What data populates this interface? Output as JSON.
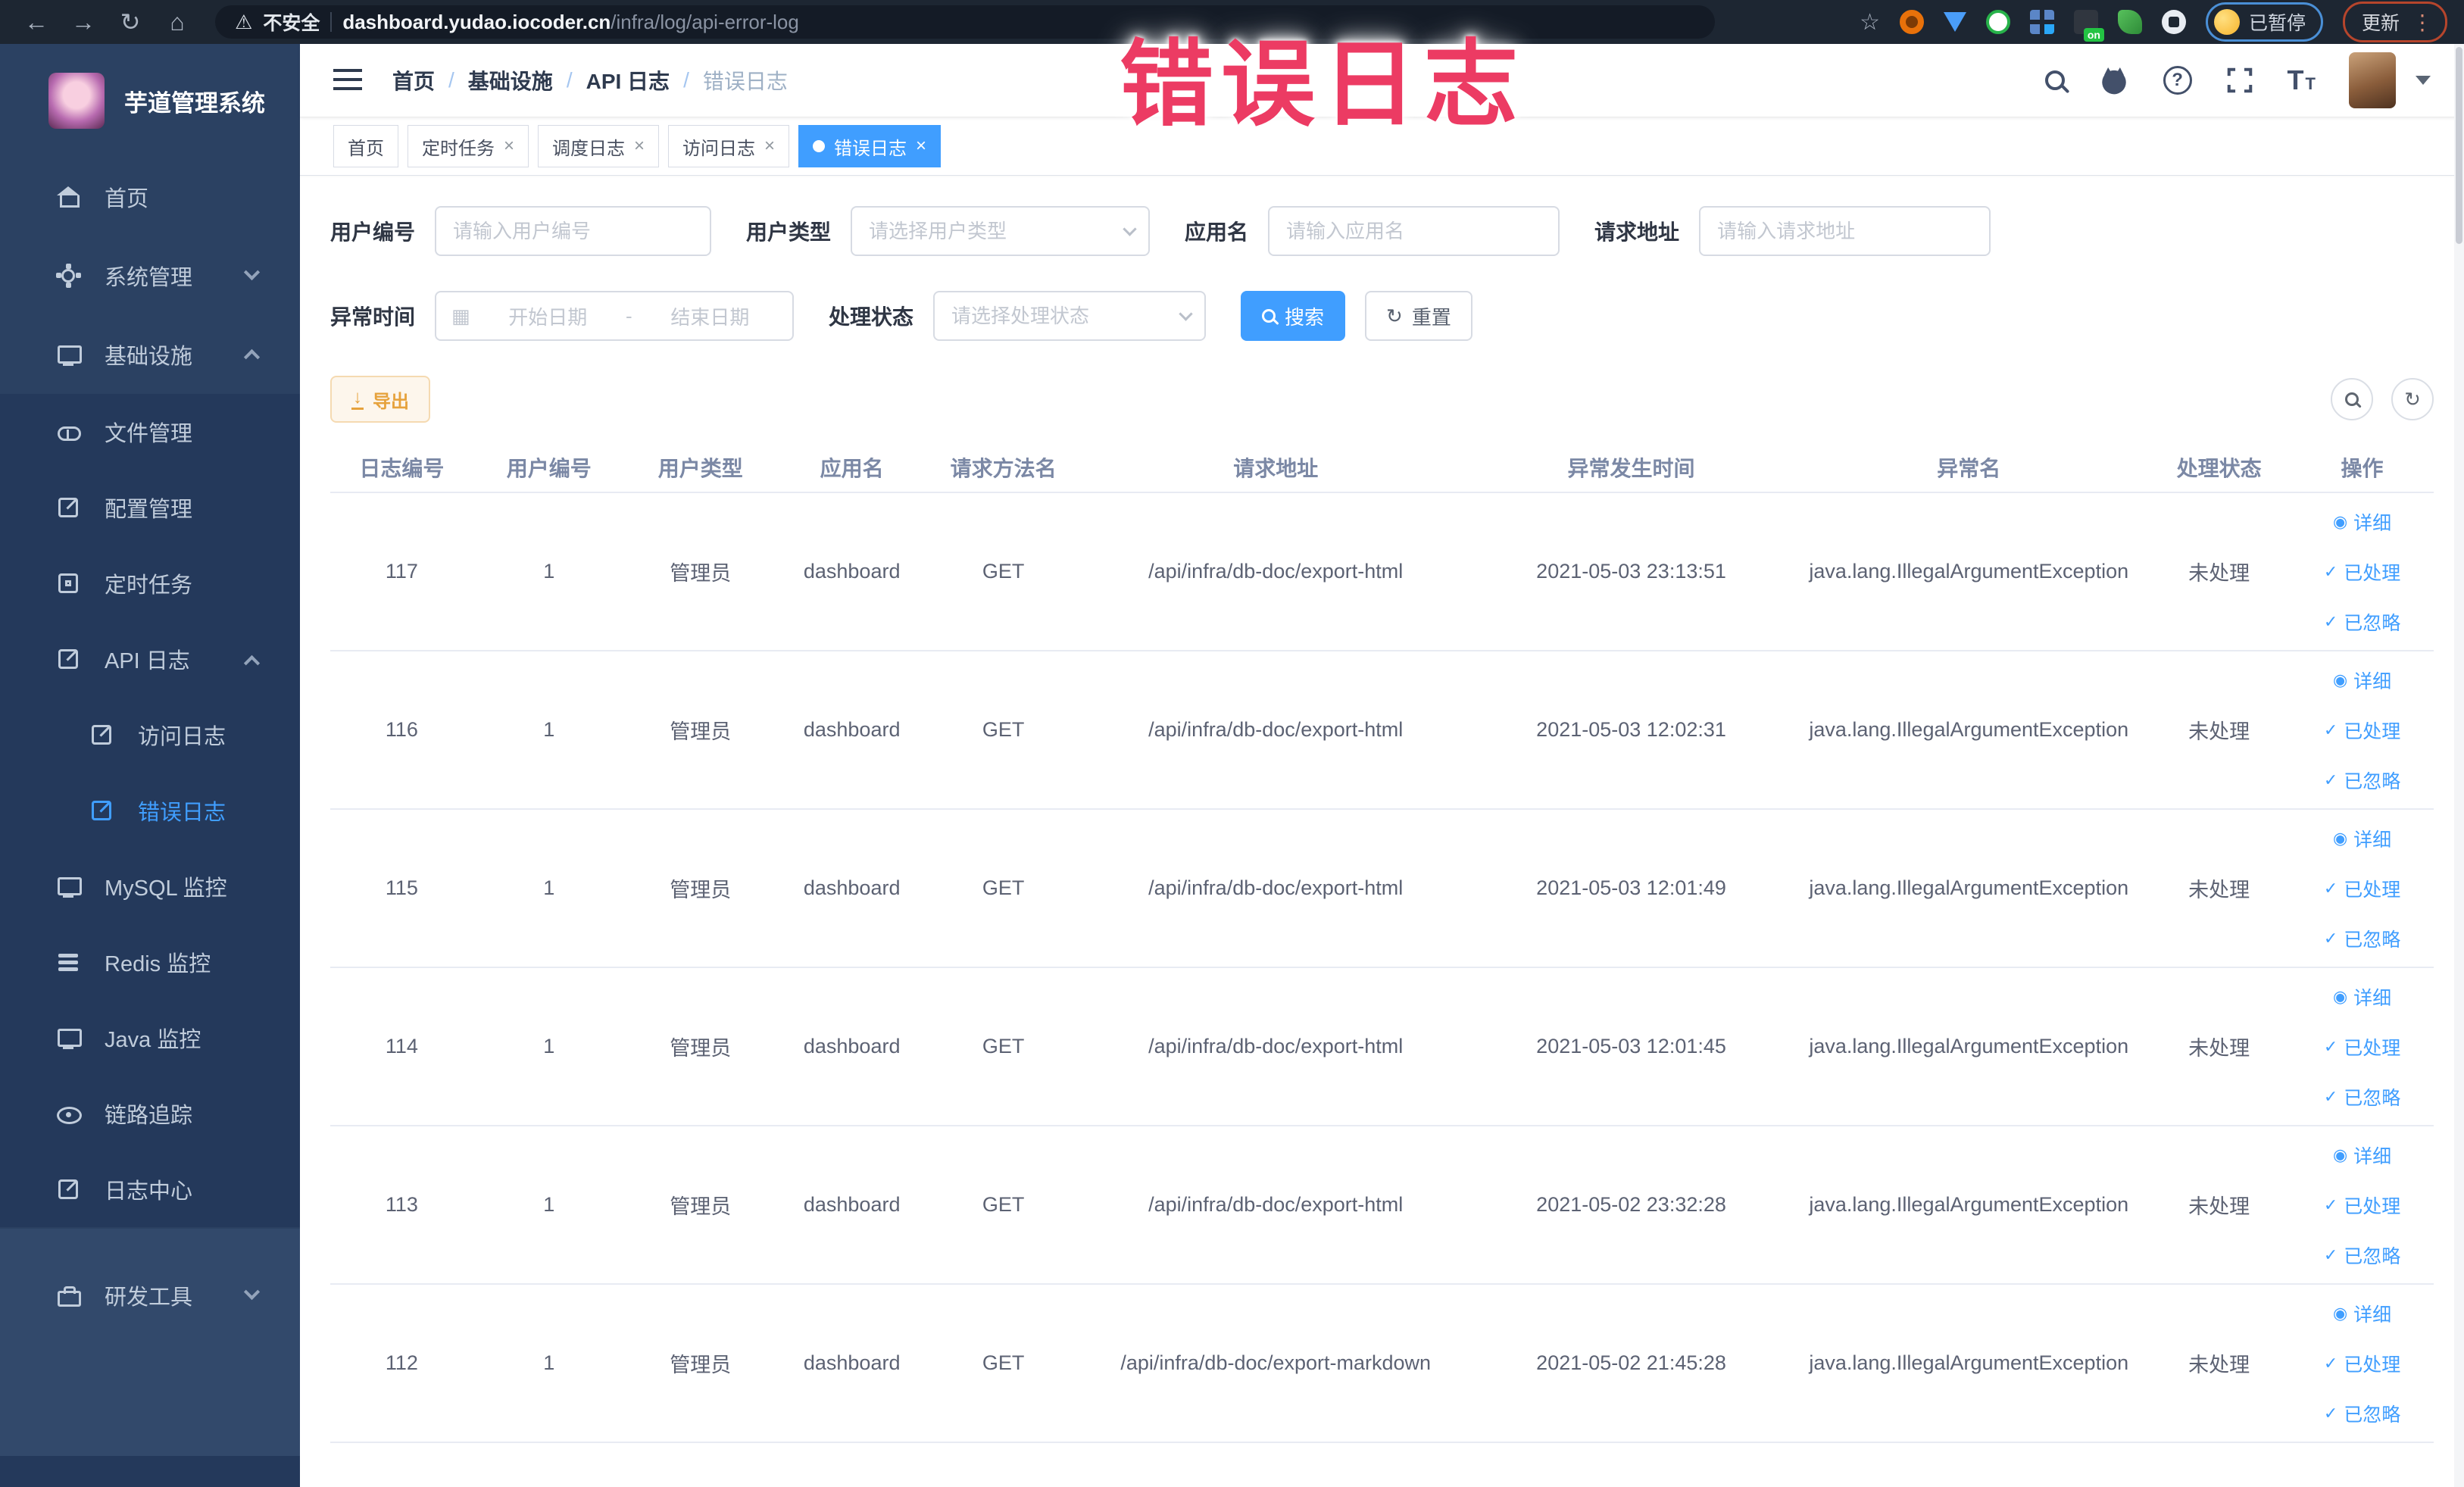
{
  "browser": {
    "security_label": "不安全",
    "url_host": "dashboard.yudao.iocoder.cn",
    "url_path": "/infra/log/api-error-log",
    "ext_on_badge": "on",
    "paused_badge": "已暂停",
    "update_button": "更新"
  },
  "overlay": {
    "title": "错误日志",
    "color": "#EC3B63"
  },
  "sidebar": {
    "app_title": "芋道管理系统",
    "items": [
      {
        "label": "首页"
      },
      {
        "label": "系统管理"
      },
      {
        "label": "基础设施"
      },
      {
        "label": "文件管理"
      },
      {
        "label": "配置管理"
      },
      {
        "label": "定时任务"
      },
      {
        "label": "API 日志"
      },
      {
        "label": "访问日志"
      },
      {
        "label": "错误日志"
      },
      {
        "label": "MySQL 监控"
      },
      {
        "label": "Redis 监控"
      },
      {
        "label": "Java 监控"
      },
      {
        "label": "链路追踪"
      },
      {
        "label": "日志中心"
      },
      {
        "label": "研发工具"
      }
    ]
  },
  "header": {
    "breadcrumb": [
      "首页",
      "基础设施",
      "API 日志",
      "错误日志"
    ],
    "separator": "/"
  },
  "tabs": [
    {
      "label": "首页"
    },
    {
      "label": "定时任务"
    },
    {
      "label": "调度日志"
    },
    {
      "label": "访问日志"
    },
    {
      "label": "错误日志"
    }
  ],
  "filters": {
    "user_id": {
      "label": "用户编号",
      "placeholder": "请输入用户编号"
    },
    "user_type": {
      "label": "用户类型",
      "placeholder": "请选择用户类型"
    },
    "app_name": {
      "label": "应用名",
      "placeholder": "请输入应用名"
    },
    "request_url": {
      "label": "请求地址",
      "placeholder": "请输入请求地址"
    },
    "exception_time": {
      "label": "异常时间",
      "start_placeholder": "开始日期",
      "separator": "-",
      "end_placeholder": "结束日期"
    },
    "process_status": {
      "label": "处理状态",
      "placeholder": "请选择处理状态"
    },
    "search_button": "搜索",
    "reset_button": "重置"
  },
  "toolbar": {
    "export_button": "导出"
  },
  "table": {
    "columns": [
      "日志编号",
      "用户编号",
      "用户类型",
      "应用名",
      "请求方法名",
      "请求地址",
      "异常发生时间",
      "异常名",
      "处理状态",
      "操作"
    ],
    "row_actions": [
      "详细",
      "已处理",
      "已忽略"
    ],
    "rows": [
      {
        "id": "117",
        "user_id": "1",
        "user_type": "管理员",
        "app": "dashboard",
        "method": "GET",
        "url": "/api/infra/db-doc/export-html",
        "time": "2021-05-03 23:13:51",
        "exception": "java.lang.IllegalArgumentException",
        "status": "未处理"
      },
      {
        "id": "116",
        "user_id": "1",
        "user_type": "管理员",
        "app": "dashboard",
        "method": "GET",
        "url": "/api/infra/db-doc/export-html",
        "time": "2021-05-03 12:02:31",
        "exception": "java.lang.IllegalArgumentException",
        "status": "未处理"
      },
      {
        "id": "115",
        "user_id": "1",
        "user_type": "管理员",
        "app": "dashboard",
        "method": "GET",
        "url": "/api/infra/db-doc/export-html",
        "time": "2021-05-03 12:01:49",
        "exception": "java.lang.IllegalArgumentException",
        "status": "未处理"
      },
      {
        "id": "114",
        "user_id": "1",
        "user_type": "管理员",
        "app": "dashboard",
        "method": "GET",
        "url": "/api/infra/db-doc/export-html",
        "time": "2021-05-03 12:01:45",
        "exception": "java.lang.IllegalArgumentException",
        "status": "未处理"
      },
      {
        "id": "113",
        "user_id": "1",
        "user_type": "管理员",
        "app": "dashboard",
        "method": "GET",
        "url": "/api/infra/db-doc/export-html",
        "time": "2021-05-02 23:32:28",
        "exception": "java.lang.IllegalArgumentException",
        "status": "未处理"
      },
      {
        "id": "112",
        "user_id": "1",
        "user_type": "管理员",
        "app": "dashboard",
        "method": "GET",
        "url": "/api/infra/db-doc/export-markdown",
        "time": "2021-05-02 21:45:28",
        "exception": "java.lang.IllegalArgumentException",
        "status": "未处理"
      }
    ]
  },
  "icons": {
    "back": "←",
    "forward": "→",
    "reload": "↻",
    "home": "⌂",
    "warning": "⚠",
    "star": "☆",
    "menu_dots": "⋮",
    "calendar": "▦",
    "download": "↓",
    "refresh": "↻",
    "eye": "◉",
    "check": "✓",
    "close": "×"
  },
  "colors": {
    "accent": "#409EFF",
    "warning": "#E6A23C",
    "sidebar": "#2B4162"
  }
}
